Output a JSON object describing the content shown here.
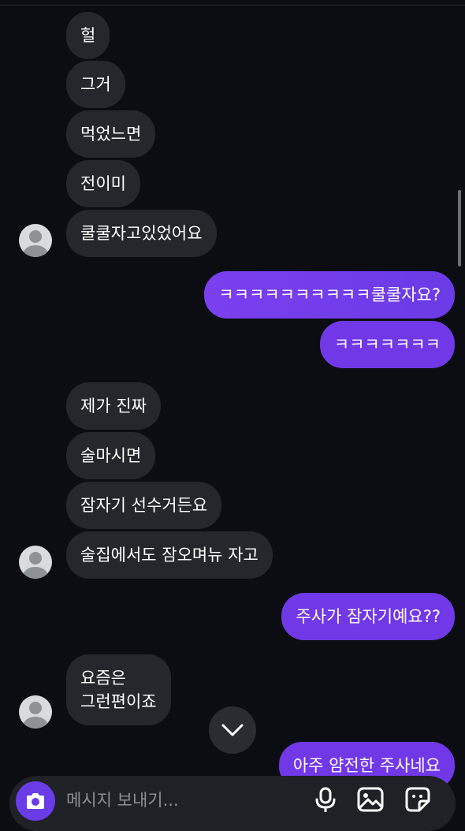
{
  "colors": {
    "background": "#0c0d12",
    "incoming_bubble": "#25272c",
    "outgoing_bubble": "#7138e8",
    "composer": "#1f2126",
    "camera_button": "#6a3ce8"
  },
  "messages": [
    {
      "direction": "incoming",
      "text": "헐"
    },
    {
      "direction": "incoming",
      "text": "그거"
    },
    {
      "direction": "incoming",
      "text": "먹었느면"
    },
    {
      "direction": "incoming",
      "text": "전이미"
    },
    {
      "direction": "incoming",
      "text": "쿨쿨자고있었어요",
      "avatar": "user-avatar-icon"
    },
    {
      "direction": "outgoing",
      "text": "ㅋㅋㅋㅋㅋㅋㅋㅋㅋㅋ쿨쿨자요?"
    },
    {
      "direction": "outgoing",
      "text": "ㅋㅋㅋㅋㅋㅋㅋ"
    },
    {
      "direction": "incoming",
      "text": "제가 진짜"
    },
    {
      "direction": "incoming",
      "text": "술마시면"
    },
    {
      "direction": "incoming",
      "text": "잠자기 선수거든요"
    },
    {
      "direction": "incoming",
      "text": "술집에서도 잠오며뉴 자고",
      "avatar": "user-avatar-icon"
    },
    {
      "direction": "outgoing",
      "text": "주사가 잠자기예요??"
    },
    {
      "direction": "incoming",
      "lines": [
        "요즘은",
        "그런편이죠"
      ],
      "avatar": "user-avatar-icon"
    },
    {
      "direction": "outgoing",
      "text": "아주 얌전한 주사네요"
    }
  ],
  "scroll_down_button": {
    "icon": "chevron-down-icon"
  },
  "composer": {
    "placeholder": "메시지 보내기...",
    "camera_icon": "camera-icon",
    "mic_icon": "microphone-icon",
    "gallery_icon": "image-icon",
    "sticker_icon": "sticker-icon"
  }
}
